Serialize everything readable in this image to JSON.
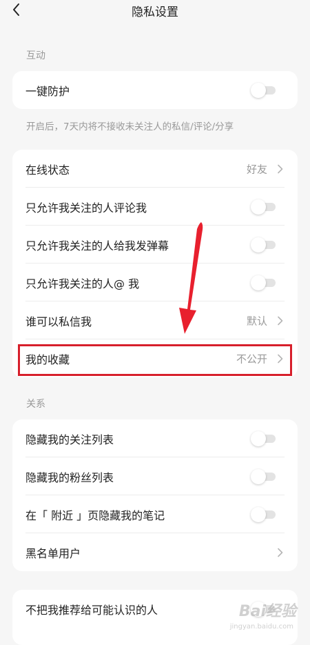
{
  "header": {
    "title": "隐私设置"
  },
  "sections": {
    "interaction": {
      "label": "互动"
    },
    "relations": {
      "label": "关系"
    }
  },
  "interaction_card": {
    "one_key_protect": {
      "label": "一键防护",
      "toggle": false
    },
    "hint": "开启后，7天内将不接收未关注人的私信/评论/分享"
  },
  "privacy_card": {
    "items": [
      {
        "label": "在线状态",
        "value": "好友",
        "type": "link"
      },
      {
        "label": "只允许我关注的人评论我",
        "toggle": false,
        "type": "toggle"
      },
      {
        "label": "只允许我关注的人给我发弹幕",
        "toggle": false,
        "type": "toggle"
      },
      {
        "label": "只允许我关注的人@ 我",
        "toggle": false,
        "type": "toggle"
      },
      {
        "label": "谁可以私信我",
        "value": "默认",
        "type": "link"
      },
      {
        "label": "我的收藏",
        "value": "不公开",
        "type": "link"
      }
    ]
  },
  "relations_card": {
    "items": [
      {
        "label": "隐藏我的关注列表",
        "toggle": false,
        "type": "toggle"
      },
      {
        "label": "隐藏我的粉丝列表",
        "toggle": false,
        "type": "toggle"
      },
      {
        "label": "在「 附近 」页隐藏我的笔记",
        "toggle": false,
        "type": "toggle"
      },
      {
        "label": "黑名单用户",
        "type": "link"
      }
    ]
  },
  "recommend_card": {
    "item": {
      "label": "不把我推荐给可能认识的人",
      "toggle": false
    }
  },
  "annotation_colors": {
    "highlight": "#d71f2b",
    "arrow": "#e8202e"
  },
  "watermark": {
    "text": "Bai经验",
    "sub": "jingyan.baidu.com"
  }
}
